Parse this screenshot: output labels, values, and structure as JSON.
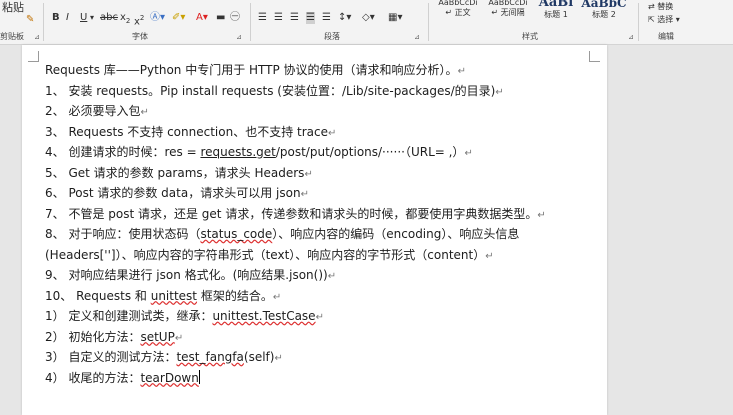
{
  "ribbon": {
    "clipboard": {
      "paste_label": "粘贴",
      "group_label": "剪贴板"
    },
    "font": {
      "group_label": "字体"
    },
    "paragraph": {
      "group_label": "段落"
    },
    "styles": {
      "group_label": "样式",
      "items": [
        {
          "preview": "AaBbCcDı",
          "label": "↵ 正文"
        },
        {
          "preview": "AaBbCcDı",
          "label": "↵ 无间隔"
        },
        {
          "preview": "AaBl",
          "label": "标题 1"
        },
        {
          "preview": "AaBbC",
          "label": "标题 2"
        }
      ]
    },
    "editing": {
      "replace_label": "替换",
      "select_label": "选择",
      "group_label": "编辑"
    }
  },
  "document": {
    "lines": [
      {
        "segs": [
          {
            "t": "Requests 库——Python 中专门用于 HTTP 协议的使用（请求和响应分析）。"
          }
        ],
        "mark": "↵"
      },
      {
        "segs": [
          {
            "t": "1、 安装 requests。Pip install requests (安装位置：/Lib/site-packages/的目录)"
          }
        ],
        "mark": "↵"
      },
      {
        "segs": [
          {
            "t": "2、 必须要导入包"
          }
        ],
        "mark": "↵"
      },
      {
        "segs": [
          {
            "t": "3、 Requests 不支持 connection、也不支持 trace"
          }
        ],
        "mark": "↵"
      },
      {
        "segs": [
          {
            "t": "4、 创建请求的时候：res = "
          },
          {
            "t": "requests.get",
            "u": true
          },
          {
            "t": "/post/put/options/······（URL= ,）"
          }
        ],
        "mark": "↵"
      },
      {
        "segs": [
          {
            "t": "5、 Get 请求的参数 params，请求头 Headers"
          }
        ],
        "mark": "↵"
      },
      {
        "segs": [
          {
            "t": "6、 Post 请求的参数 data，请求头可以用 json"
          }
        ],
        "mark": "↵"
      },
      {
        "segs": [
          {
            "t": "7、 不管是 post 请求，还是 get 请求，传递参数和请求头的时候，都要使用字典数据类型。"
          }
        ],
        "mark": "↵"
      },
      {
        "segs": [
          {
            "t": "8、 对于响应：使用状态码（"
          },
          {
            "t": "status_code",
            "sq": true
          },
          {
            "t": "）、响应内容的编码（encoding）、响应头信息"
          }
        ],
        "mark": ""
      },
      {
        "segs": [
          {
            "t": "     (Headers['']）、响应内容的字符串形式（text）、响应内容的字节形式（content）"
          }
        ],
        "mark": "↵"
      },
      {
        "segs": [
          {
            "t": "9、 对响应结果进行 json 格式化。(响应结果.json())"
          }
        ],
        "mark": "↵"
      },
      {
        "segs": [
          {
            "t": "10、       Requests 和 "
          },
          {
            "t": "unittest",
            "sq": true
          },
          {
            "t": " 框架的结合。"
          }
        ],
        "mark": "↵"
      },
      {
        "segs": [
          {
            "t": "    1） 定义和创建测试类，继承："
          },
          {
            "t": "unittest.TestCase",
            "sq": true
          }
        ],
        "mark": "↵"
      },
      {
        "segs": [
          {
            "t": "    2） 初始化方法："
          },
          {
            "t": "setUP",
            "sq": true
          }
        ],
        "mark": "↵"
      },
      {
        "segs": [
          {
            "t": "    3） 自定义的测试方法："
          },
          {
            "t": "test_fangfa",
            "sq": true
          },
          {
            "t": "(self)"
          }
        ],
        "mark": "↵"
      },
      {
        "segs": [
          {
            "t": "    4） 收尾的方法："
          },
          {
            "t": "tearDown",
            "sq": true
          }
        ],
        "mark": "caret"
      }
    ]
  }
}
